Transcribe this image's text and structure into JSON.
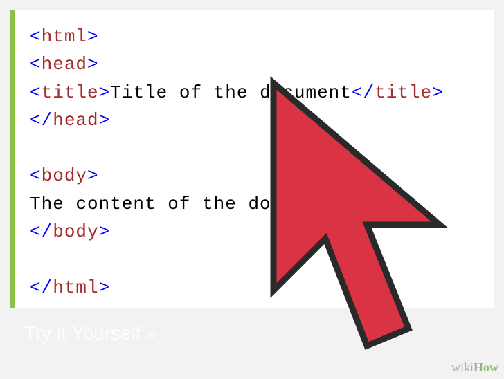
{
  "code": {
    "lines": [
      {
        "type": "tag",
        "open": "<",
        "name": "html",
        "close": ">"
      },
      {
        "type": "tag",
        "open": "<",
        "name": "head",
        "close": ">"
      },
      {
        "type": "tag_with_text",
        "open": "<",
        "name": "title",
        "mid": ">",
        "text": "Title of the document",
        "open2": "</",
        "name2": "title",
        "close2": ">"
      },
      {
        "type": "tag",
        "open": "</",
        "name": "head",
        "close": ">"
      },
      {
        "type": "empty"
      },
      {
        "type": "tag",
        "open": "<",
        "name": "body",
        "close": ">"
      },
      {
        "type": "text",
        "text": "The content of the document......"
      },
      {
        "type": "tag",
        "open": "</",
        "name": "body",
        "close": ">"
      },
      {
        "type": "empty"
      },
      {
        "type": "tag",
        "open": "</",
        "name": "html",
        "close": ">"
      }
    ]
  },
  "watermark": {
    "wiki": "wiki",
    "how": "How"
  },
  "faint": "Try it Yourself »",
  "cursor": {
    "fill": "#d93344",
    "stroke": "#2a2a2a"
  }
}
